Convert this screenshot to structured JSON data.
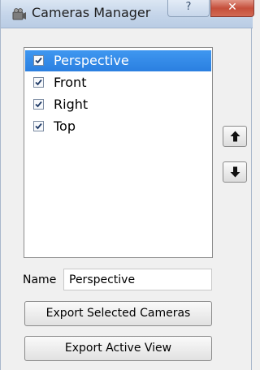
{
  "window": {
    "title": "Cameras Manager",
    "help_glyph": "?",
    "close_glyph": "✕"
  },
  "cameras": [
    {
      "label": "Perspective",
      "checked": true,
      "selected": true
    },
    {
      "label": "Front",
      "checked": true,
      "selected": false
    },
    {
      "label": "Right",
      "checked": true,
      "selected": false
    },
    {
      "label": "Top",
      "checked": true,
      "selected": false
    }
  ],
  "controls": {
    "move_up_icon": "arrow-up-icon",
    "move_down_icon": "arrow-down-icon"
  },
  "name_field": {
    "label": "Name",
    "value": "Perspective"
  },
  "actions": {
    "export_selected": "Export Selected Cameras",
    "export_active": "Export Active View"
  },
  "colors": {
    "selection": "#2f86e6",
    "close_button": "#c54f3b"
  }
}
